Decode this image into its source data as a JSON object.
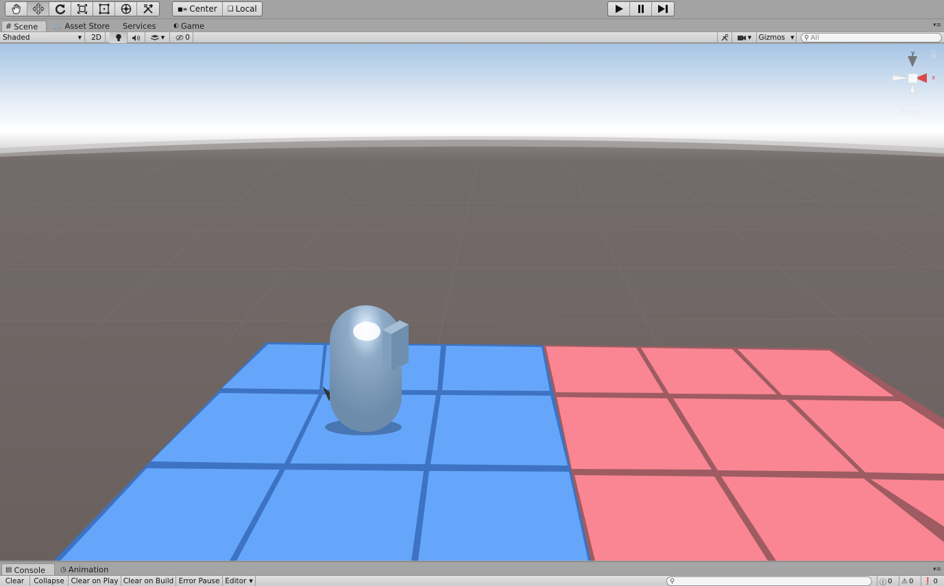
{
  "toolbar": {
    "transform_tools": [
      {
        "name": "hand-tool",
        "icon": "hand-icon",
        "active": false
      },
      {
        "name": "move-tool",
        "icon": "move-arrows-icon",
        "active": true
      },
      {
        "name": "rotate-tool",
        "icon": "rotate-icon",
        "active": false
      },
      {
        "name": "scale-tool",
        "icon": "scale-icon",
        "active": false
      },
      {
        "name": "rect-tool",
        "icon": "rect-transform-icon",
        "active": false
      },
      {
        "name": "transform-tool",
        "icon": "combined-transform-icon",
        "active": false
      },
      {
        "name": "custom-tool",
        "icon": "tools-icon",
        "active": false
      }
    ],
    "pivot_label": "Center",
    "space_label": "Local",
    "play_icon": "play-icon",
    "pause_icon": "pause-icon",
    "step_icon": "step-icon"
  },
  "tabs": [
    {
      "label": "Scene",
      "icon": "scene-grid-icon",
      "active": true
    },
    {
      "label": "Asset Store",
      "icon": "asset-store-icon",
      "active": false
    },
    {
      "label": "Services",
      "icon": "",
      "active": false
    },
    {
      "label": "Game",
      "icon": "game-pacman-icon",
      "active": false
    }
  ],
  "scene_toolbar": {
    "draw_mode": "Shaded",
    "mode_2d": "2D",
    "hidden_count": "0",
    "gizmos_label": "Gizmos",
    "search_placeholder": "All"
  },
  "scene": {
    "persp_label": "Persp",
    "gizmo_y_label": "y",
    "gizmo_x_label": "x",
    "colors": {
      "sky_top": "#a6c4e4",
      "horizon": "#eef4f8",
      "ground": "#6a605e",
      "blue_tile": "#66a6fa",
      "blue_line": "#3d73c2",
      "red_tile": "#f98692",
      "red_line": "#9e5c62",
      "capsule": "#7f9fbc"
    }
  },
  "console": {
    "tabs": [
      {
        "label": "Console",
        "icon": "console-icon",
        "active": true
      },
      {
        "label": "Animation",
        "icon": "clock-icon",
        "active": false
      }
    ],
    "buttons": {
      "clear": "Clear",
      "collapse": "Collapse",
      "clear_on_play": "Clear on Play",
      "clear_on_build": "Clear on Build",
      "error_pause": "Error Pause",
      "editor": "Editor"
    },
    "log_count": "0",
    "warning_count": "0",
    "error_count": "0"
  }
}
